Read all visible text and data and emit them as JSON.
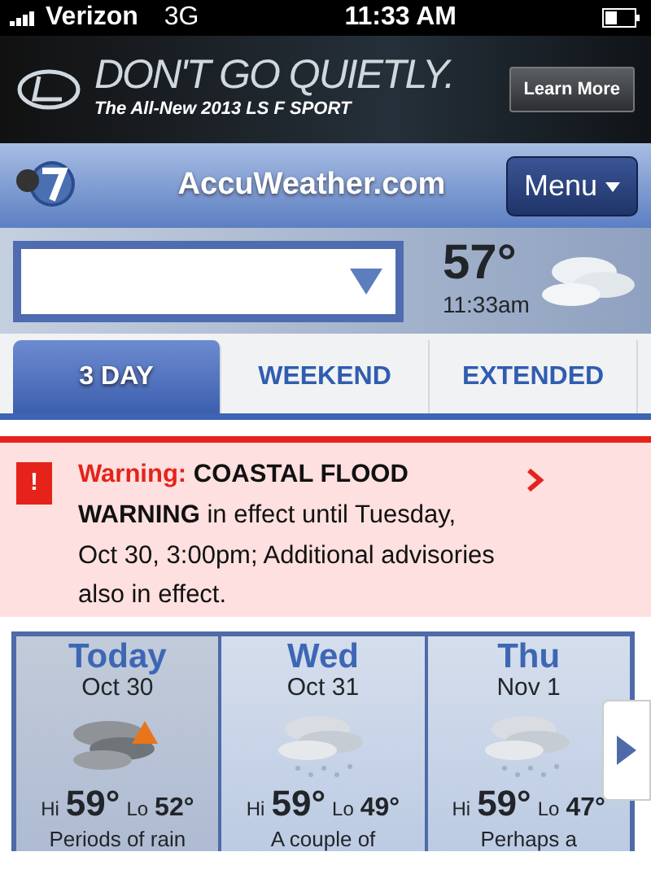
{
  "status_bar": {
    "carrier": "Verizon",
    "network": "3G",
    "time": "11:33 AM"
  },
  "ad": {
    "headline": "DON'T GO QUIETLY.",
    "subline": "The All-New 2013 LS F SPORT",
    "button": "Learn More"
  },
  "header": {
    "site": "AccuWeather.com",
    "menu": "Menu"
  },
  "current": {
    "temperature": "57°",
    "time": "11:33am"
  },
  "tabs": [
    {
      "label": "3 DAY",
      "selected": true
    },
    {
      "label": "WEEKEND",
      "selected": false
    },
    {
      "label": "EXTENDED",
      "selected": false
    }
  ],
  "alert": {
    "icon": "!",
    "label": "Warning:",
    "text": "**COASTAL FLOOD WARNING** in effect until Tuesday, Oct 30, 3:00pm; Additional advisories also in effect."
  },
  "forecast": [
    {
      "day": "Today",
      "date": "Oct 30",
      "kind": "storm",
      "hi_label": "Hi",
      "hi": "59°",
      "lo_label": "Lo",
      "lo": "52°",
      "summary": "Periods of rain",
      "selected": true
    },
    {
      "day": "Wed",
      "date": "Oct 31",
      "kind": "rain",
      "hi_label": "Hi",
      "hi": "59°",
      "lo_label": "Lo",
      "lo": "49°",
      "summary": "A couple of",
      "selected": false
    },
    {
      "day": "Thu",
      "date": "Nov 1",
      "kind": "rain",
      "hi_label": "Hi",
      "hi": "59°",
      "lo_label": "Lo",
      "lo": "47°",
      "summary": "Perhaps a",
      "selected": false
    }
  ]
}
